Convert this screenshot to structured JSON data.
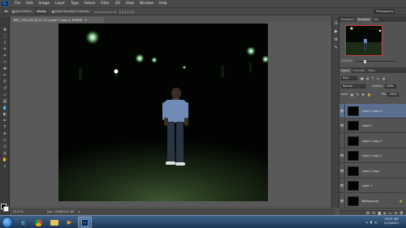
{
  "menubar": {
    "logo": "Ps",
    "items": [
      "File",
      "Edit",
      "Image",
      "Layer",
      "Type",
      "Select",
      "Filter",
      "3D",
      "View",
      "Window",
      "Help"
    ]
  },
  "options": {
    "auto_select": "Auto-Select:",
    "auto_select_value": "Group",
    "transform_controls": "Show Transform Controls",
    "workspace": "Photography"
  },
  "document": {
    "tab_title": "IMG_7351.JPG @ 22.7% (Layer 1 copy 4, RGB/8)",
    "close": "×"
  },
  "status": {
    "zoom": "22.27%",
    "doc_size": "Doc: 10.8M/131.3M"
  },
  "navigator": {
    "tabs": [
      "Histogram",
      "Navigator",
      "Info"
    ],
    "active_tab": "Navigator",
    "zoom": "22.27%"
  },
  "layers_panel": {
    "tabs": [
      "Layers",
      "Channels",
      "Paths"
    ],
    "active_tab": "Layers",
    "kind": "Kind",
    "blend_mode": "Normal",
    "opacity_label": "Opacity:",
    "opacity": "100%",
    "lock_label": "Lock:",
    "fill_label": "Fill:",
    "fill": "100%",
    "layers": [
      {
        "name": "Layer 1 copy 4",
        "selected": true,
        "visible": true
      },
      {
        "name": "Layer 2",
        "selected": false,
        "visible": true
      },
      {
        "name": "Layer 1 copy 3",
        "selected": false,
        "visible": false
      },
      {
        "name": "Layer 1 copy 2",
        "selected": false,
        "visible": true
      },
      {
        "name": "Layer 1 copy",
        "selected": false,
        "visible": true
      },
      {
        "name": "Layer 1",
        "selected": false,
        "visible": true
      },
      {
        "name": "Background",
        "selected": false,
        "visible": true
      }
    ]
  },
  "taskbar": {
    "time": "10:01 AM",
    "date": "11/3/2011"
  },
  "colors": {
    "selected_layer": "#5b6e8f",
    "panel_bg": "#535353",
    "taskbar": "#2d4a6b"
  }
}
